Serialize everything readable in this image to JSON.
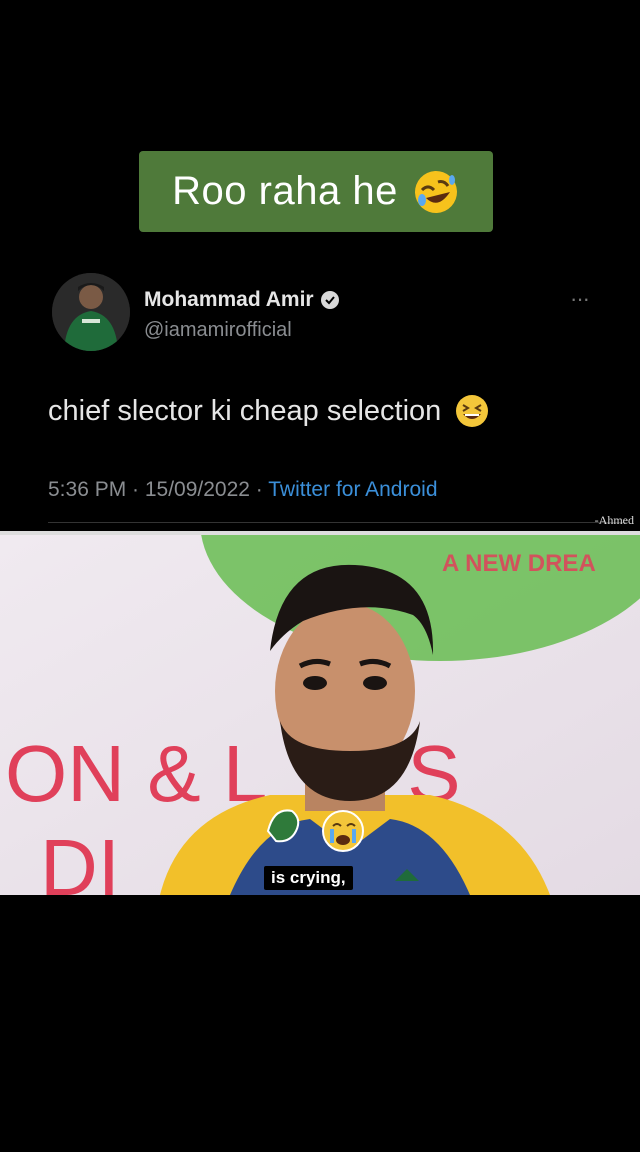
{
  "caption": {
    "text": "Roo raha he",
    "emoji": "rolling-on-floor-laughing-emoji"
  },
  "tweet": {
    "display_name": "Mohammad Amir",
    "handle": "@iamamirofficial",
    "more_label": "···",
    "text": "chief slector ki cheap  selection",
    "text_emoji": "grinning-squinting-emoji",
    "time": "5:36 PM · 15/09/2022 · ",
    "source": "Twitter for Android"
  },
  "watermark": "-Ahmed",
  "video": {
    "backdrop_text_1": "A NEW DREA",
    "backdrop_text_2": "ON & L",
    "backdrop_text_3": "'S",
    "backdrop_text_4": "DI",
    "subtitle": "is crying,",
    "sticker_icons": [
      "green-character-icon",
      "crying-face-emoji"
    ]
  },
  "colors": {
    "caption_bg": "#4f7a3a",
    "link": "#3b8fd9",
    "backdrop_red": "#e0405a",
    "backdrop_green": "#6fbf5a",
    "jersey_yellow": "#f2c02a"
  }
}
